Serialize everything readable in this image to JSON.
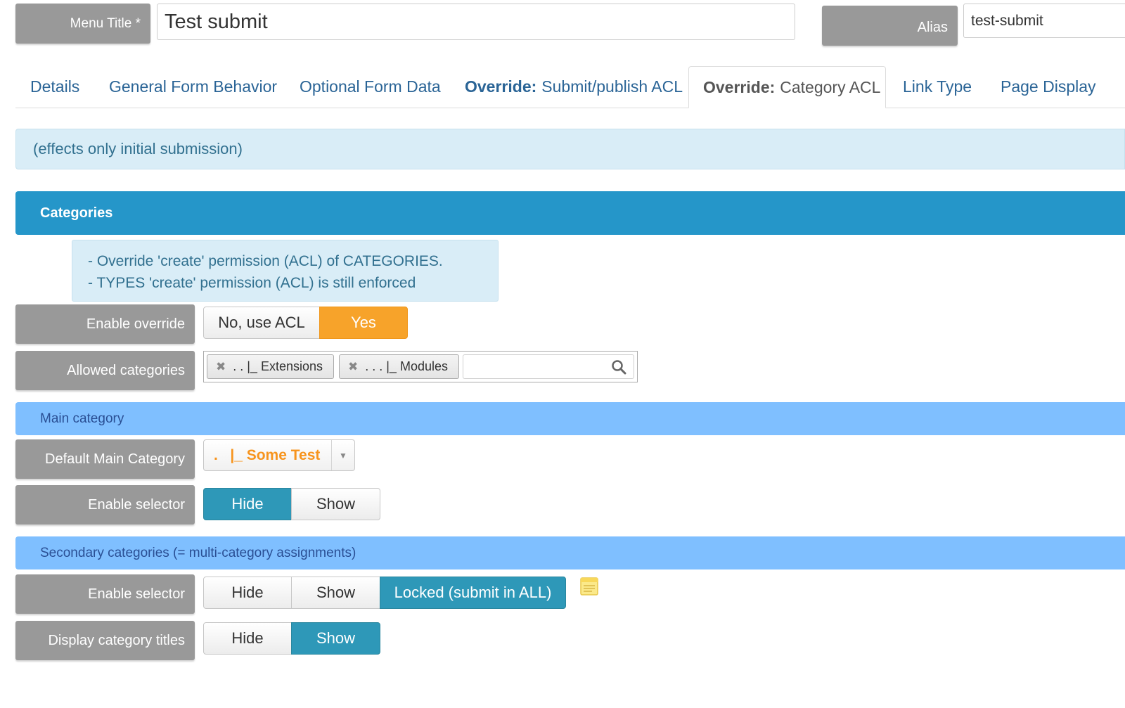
{
  "header": {
    "menu_title_label": "Menu Title *",
    "menu_title_value": "Test submit",
    "alias_label": "Alias",
    "alias_value": "test-submit"
  },
  "tabs": [
    {
      "prefix": "",
      "label": "Details",
      "active": false
    },
    {
      "prefix": "",
      "label": "General Form Behavior",
      "active": false
    },
    {
      "prefix": "",
      "label": "Optional Form Data",
      "active": false
    },
    {
      "prefix": "Override:",
      "label": "Submit/publish ACL",
      "active": false
    },
    {
      "prefix": "Override:",
      "label": "Category ACL",
      "active": true
    },
    {
      "prefix": "",
      "label": "Link Type",
      "active": false
    },
    {
      "prefix": "",
      "label": "Page Display",
      "active": false
    }
  ],
  "info_text": "(effects only initial submission)",
  "categories": {
    "header": "Categories",
    "note_line1": "- Override 'create' permission (ACL) of CATEGORIES.",
    "note_line2": "- TYPES 'create' permission (ACL) is still enforced",
    "enable_override": {
      "label": "Enable override",
      "options": [
        "No, use ACL",
        "Yes"
      ],
      "selected": "Yes"
    },
    "allowed_categories": {
      "label": "Allowed categories",
      "chips": [
        ". . |_ Extensions",
        ". . . |_ Modules"
      ],
      "chip_remove_icon": "close-icon",
      "search_icon": "search-icon"
    }
  },
  "main_category": {
    "header": "Main category",
    "default": {
      "label": "Default Main Category",
      "value": ".   |_ Some Test"
    },
    "enable_selector": {
      "label": "Enable selector",
      "options": [
        "Hide",
        "Show"
      ],
      "selected": "Hide"
    }
  },
  "secondary_categories": {
    "header": "Secondary categories (= multi-category assignments)",
    "enable_selector": {
      "label": "Enable selector",
      "options": [
        "Hide",
        "Show",
        "Locked (submit in ALL)"
      ],
      "selected": "Locked (submit in ALL)"
    },
    "display_titles": {
      "label": "Display category titles",
      "options": [
        "Hide",
        "Show"
      ],
      "selected": "Show"
    },
    "note_icon": "note-icon"
  },
  "colors": {
    "accent_blue": "#2596c9",
    "light_blue": "#7fbfff",
    "info_bg": "#d9edf7",
    "orange": "#f7a32a",
    "teal": "#2e98b8",
    "label_grey": "#999999"
  }
}
